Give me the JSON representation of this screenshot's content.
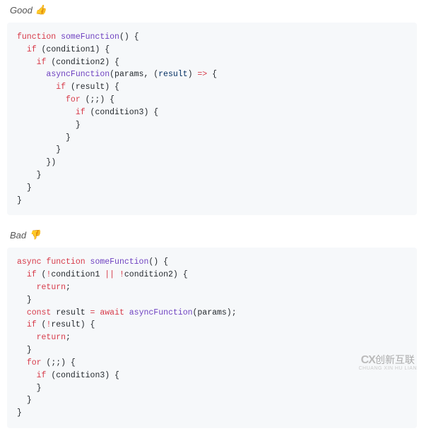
{
  "good": {
    "label": "Good",
    "emoji": "👍",
    "code_lines": [
      {
        "indent": 0,
        "tokens": [
          {
            "t": "function ",
            "c": "kw"
          },
          {
            "t": "someFunction",
            "c": "fn"
          },
          {
            "t": "() {",
            "c": ""
          }
        ]
      },
      {
        "indent": 1,
        "tokens": [
          {
            "t": "if ",
            "c": "kw"
          },
          {
            "t": "(condition1) {",
            "c": ""
          }
        ]
      },
      {
        "indent": 2,
        "tokens": [
          {
            "t": "if ",
            "c": "kw"
          },
          {
            "t": "(condition2) {",
            "c": ""
          }
        ]
      },
      {
        "indent": 3,
        "tokens": [
          {
            "t": "asyncFunction",
            "c": "fn"
          },
          {
            "t": "(params, (",
            "c": ""
          },
          {
            "t": "result",
            "c": "id"
          },
          {
            "t": ") ",
            "c": ""
          },
          {
            "t": "=>",
            "c": "op"
          },
          {
            "t": " {",
            "c": ""
          }
        ]
      },
      {
        "indent": 4,
        "tokens": [
          {
            "t": "if ",
            "c": "kw"
          },
          {
            "t": "(result) {",
            "c": ""
          }
        ]
      },
      {
        "indent": 5,
        "tokens": [
          {
            "t": "for ",
            "c": "kw"
          },
          {
            "t": "(;;) {",
            "c": ""
          }
        ]
      },
      {
        "indent": 6,
        "tokens": [
          {
            "t": "if ",
            "c": "kw"
          },
          {
            "t": "(condition3) {",
            "c": ""
          }
        ]
      },
      {
        "indent": 6,
        "tokens": [
          {
            "t": "}",
            "c": ""
          }
        ]
      },
      {
        "indent": 5,
        "tokens": [
          {
            "t": "}",
            "c": ""
          }
        ]
      },
      {
        "indent": 4,
        "tokens": [
          {
            "t": "}",
            "c": ""
          }
        ]
      },
      {
        "indent": 3,
        "tokens": [
          {
            "t": "})",
            "c": ""
          }
        ]
      },
      {
        "indent": 2,
        "tokens": [
          {
            "t": "}",
            "c": ""
          }
        ]
      },
      {
        "indent": 1,
        "tokens": [
          {
            "t": "}",
            "c": ""
          }
        ]
      },
      {
        "indent": 0,
        "tokens": [
          {
            "t": "}",
            "c": ""
          }
        ]
      }
    ]
  },
  "bad": {
    "label": "Bad",
    "emoji": "👎",
    "code_lines": [
      {
        "indent": 0,
        "tokens": [
          {
            "t": "async ",
            "c": "kw"
          },
          {
            "t": "function ",
            "c": "kw"
          },
          {
            "t": "someFunction",
            "c": "fn"
          },
          {
            "t": "() {",
            "c": ""
          }
        ]
      },
      {
        "indent": 1,
        "tokens": [
          {
            "t": "if ",
            "c": "kw"
          },
          {
            "t": "(",
            "c": ""
          },
          {
            "t": "!",
            "c": "op"
          },
          {
            "t": "condition1 ",
            "c": ""
          },
          {
            "t": "||",
            "c": "op"
          },
          {
            "t": " ",
            "c": ""
          },
          {
            "t": "!",
            "c": "op"
          },
          {
            "t": "condition2) {",
            "c": ""
          }
        ]
      },
      {
        "indent": 2,
        "tokens": [
          {
            "t": "return",
            "c": "kw"
          },
          {
            "t": ";",
            "c": ""
          }
        ]
      },
      {
        "indent": 1,
        "tokens": [
          {
            "t": "}",
            "c": ""
          }
        ]
      },
      {
        "indent": 0,
        "tokens": [
          {
            "t": "",
            "c": ""
          }
        ]
      },
      {
        "indent": 1,
        "tokens": [
          {
            "t": "const ",
            "c": "kw"
          },
          {
            "t": "result ",
            "c": ""
          },
          {
            "t": "=",
            "c": "op"
          },
          {
            "t": " ",
            "c": ""
          },
          {
            "t": "await ",
            "c": "kw"
          },
          {
            "t": "asyncFunction",
            "c": "fn"
          },
          {
            "t": "(params);",
            "c": ""
          }
        ]
      },
      {
        "indent": 1,
        "tokens": [
          {
            "t": "if ",
            "c": "kw"
          },
          {
            "t": "(",
            "c": ""
          },
          {
            "t": "!",
            "c": "op"
          },
          {
            "t": "result) {",
            "c": ""
          }
        ]
      },
      {
        "indent": 2,
        "tokens": [
          {
            "t": "return",
            "c": "kw"
          },
          {
            "t": ";",
            "c": ""
          }
        ]
      },
      {
        "indent": 1,
        "tokens": [
          {
            "t": "}",
            "c": ""
          }
        ]
      },
      {
        "indent": 0,
        "tokens": [
          {
            "t": "",
            "c": ""
          }
        ]
      },
      {
        "indent": 1,
        "tokens": [
          {
            "t": "for ",
            "c": "kw"
          },
          {
            "t": "(;;) {",
            "c": ""
          }
        ]
      },
      {
        "indent": 2,
        "tokens": [
          {
            "t": "if ",
            "c": "kw"
          },
          {
            "t": "(condition3) {",
            "c": ""
          }
        ]
      },
      {
        "indent": 2,
        "tokens": [
          {
            "t": "}",
            "c": ""
          }
        ]
      },
      {
        "indent": 1,
        "tokens": [
          {
            "t": "}",
            "c": ""
          }
        ]
      },
      {
        "indent": 0,
        "tokens": [
          {
            "t": "}",
            "c": ""
          }
        ]
      }
    ]
  },
  "watermark": {
    "logo_prefix": "CX",
    "brand": "创新互联",
    "sub": "CHUANG XIN HU LIAN"
  }
}
